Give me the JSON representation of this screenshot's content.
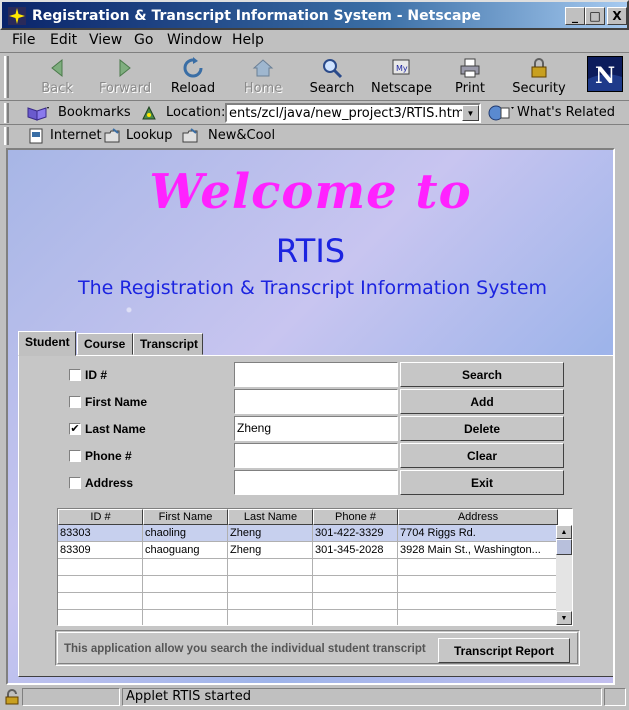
{
  "window": {
    "title": "Registration & Transcript Information System - Netscape",
    "controls": {
      "minimize": "_",
      "maximize": "□",
      "close": "X"
    }
  },
  "menu": [
    "File",
    "Edit",
    "View",
    "Go",
    "Window",
    "Help"
  ],
  "toolbar": {
    "buttons": [
      {
        "label": "Back",
        "icon": "back-icon",
        "enabled": false
      },
      {
        "label": "Forward",
        "icon": "forward-icon",
        "enabled": false
      },
      {
        "label": "Reload",
        "icon": "reload-icon",
        "enabled": true
      },
      {
        "label": "Home",
        "icon": "home-icon",
        "enabled": false
      },
      {
        "label": "Search",
        "icon": "search-icon",
        "enabled": true
      },
      {
        "label": "Netscape",
        "icon": "netscape-icon",
        "enabled": true
      },
      {
        "label": "Print",
        "icon": "print-icon",
        "enabled": true
      },
      {
        "label": "Security",
        "icon": "lock-icon",
        "enabled": true
      }
    ],
    "logo": "N"
  },
  "locationbar": {
    "bookmarks_label": "Bookmarks",
    "location_label": "Location:",
    "url": "ents/zcl/java/new_project3/RTIS.htm",
    "related_label": "What's Related"
  },
  "personalbar": {
    "items": [
      "Internet",
      "Lookup",
      "New&Cool"
    ]
  },
  "page": {
    "welcome": "Welcome to",
    "rtis": "RTIS",
    "subtitle": "The Registration & Transcript Information System"
  },
  "tabs": [
    "Student",
    "Course",
    "Transcript"
  ],
  "form": {
    "fields": [
      {
        "label": "ID #",
        "checked": false,
        "value": ""
      },
      {
        "label": "First Name",
        "checked": false,
        "value": ""
      },
      {
        "label": "Last Name",
        "checked": true,
        "value": "Zheng"
      },
      {
        "label": "Phone #",
        "checked": false,
        "value": ""
      },
      {
        "label": "Address",
        "checked": false,
        "value": ""
      }
    ],
    "buttons": [
      "Search",
      "Add",
      "Delete",
      "Clear",
      "Exit"
    ]
  },
  "table": {
    "columns": [
      "ID #",
      "First Name",
      "Last Name",
      "Phone #",
      "Address"
    ],
    "rows": [
      [
        "83303",
        "chaoling",
        "Zheng",
        "301-422-3329",
        "7704 Riggs Rd."
      ],
      [
        "83309",
        "chaoguang",
        "Zheng",
        "301-345-2028",
        "3928 Main St., Washington..."
      ]
    ],
    "selected_row": 0
  },
  "footer": {
    "message": "This application allow you search the individual student transcript",
    "report_button": "Transcript Report"
  },
  "status": {
    "text": "Applet RTIS started"
  },
  "colors": {
    "welcome": "#ff22ff",
    "heading": "#1c24e0",
    "titlebar": "#0a246a"
  }
}
